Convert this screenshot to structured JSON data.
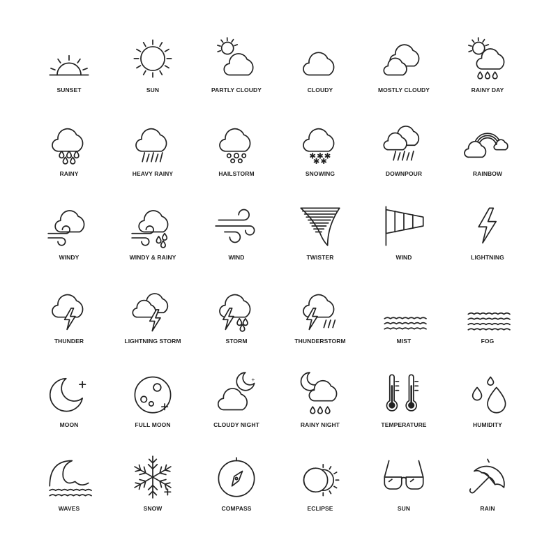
{
  "colors": {
    "stroke": "#222222",
    "background": "#ffffff"
  },
  "icons": [
    {
      "label": "SUNSET",
      "icon": "sunset-icon"
    },
    {
      "label": "SUN",
      "icon": "sun-icon"
    },
    {
      "label": "PARTLY CLOUDY",
      "icon": "partly-cloudy-icon"
    },
    {
      "label": "CLOUDY",
      "icon": "cloudy-icon"
    },
    {
      "label": "MOSTLY CLOUDY",
      "icon": "mostly-cloudy-icon"
    },
    {
      "label": "RAINY DAY",
      "icon": "rainy-day-icon"
    },
    {
      "label": "RAINY",
      "icon": "rainy-icon"
    },
    {
      "label": "HEAVY RAINY",
      "icon": "heavy-rainy-icon"
    },
    {
      "label": "HAILSTORM",
      "icon": "hailstorm-icon"
    },
    {
      "label": "SNOWING",
      "icon": "snowing-icon"
    },
    {
      "label": "DOWNPOUR",
      "icon": "downpour-icon"
    },
    {
      "label": "RAINBOW",
      "icon": "rainbow-icon"
    },
    {
      "label": "WINDY",
      "icon": "windy-icon"
    },
    {
      "label": "WINDY & RAINY",
      "icon": "windy-rainy-icon"
    },
    {
      "label": "WIND",
      "icon": "wind-icon"
    },
    {
      "label": "TWISTER",
      "icon": "twister-icon"
    },
    {
      "label": "WIND",
      "icon": "windsock-icon"
    },
    {
      "label": "LIGHTNING",
      "icon": "lightning-icon"
    },
    {
      "label": "THUNDER",
      "icon": "thunder-icon"
    },
    {
      "label": "LIGHTNING STORM",
      "icon": "lightning-storm-icon"
    },
    {
      "label": "STORM",
      "icon": "storm-icon"
    },
    {
      "label": "THUNDERSTORM",
      "icon": "thunderstorm-icon"
    },
    {
      "label": "MIST",
      "icon": "mist-icon"
    },
    {
      "label": "FOG",
      "icon": "fog-icon"
    },
    {
      "label": "MOON",
      "icon": "moon-icon"
    },
    {
      "label": "FULL MOON",
      "icon": "full-moon-icon"
    },
    {
      "label": "CLOUDY NIGHT",
      "icon": "cloudy-night-icon"
    },
    {
      "label": "RAINY NIGHT",
      "icon": "rainy-night-icon"
    },
    {
      "label": "TEMPERATURE",
      "icon": "temperature-icon"
    },
    {
      "label": "HUMIDITY",
      "icon": "humidity-icon"
    },
    {
      "label": "WAVES",
      "icon": "waves-icon"
    },
    {
      "label": "SNOW",
      "icon": "snowflake-icon"
    },
    {
      "label": "COMPASS",
      "icon": "compass-icon"
    },
    {
      "label": "ECLIPSE",
      "icon": "eclipse-icon"
    },
    {
      "label": "SUN",
      "icon": "sunglasses-icon"
    },
    {
      "label": "RAIN",
      "icon": "umbrella-icon"
    }
  ]
}
